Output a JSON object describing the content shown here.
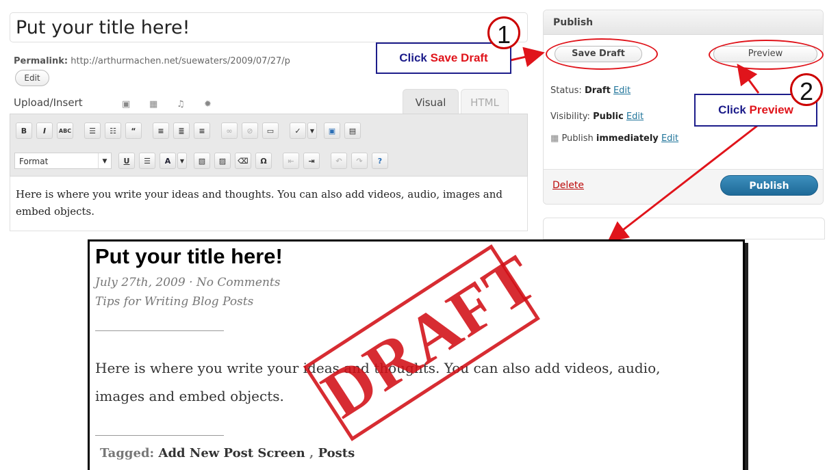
{
  "editor": {
    "title_value": "Put your title here!",
    "permalink_label": "Permalink:",
    "permalink_url": "http://arthurmachen.net/suewaters/2009/07/27/p",
    "edit_button": "Edit",
    "upload_insert_label": "Upload/Insert",
    "tabs": {
      "visual": "Visual",
      "html": "HTML"
    },
    "format_select": "Format",
    "body_text": "Here is where you write your ideas and thoughts.  You can also add videos, audio, images and embed objects."
  },
  "publish": {
    "header": "Publish",
    "save_draft_button": "Save Draft",
    "preview_button": "Preview",
    "status_label": "Status:",
    "status_value": "Draft",
    "visibility_label": "Visibility:",
    "visibility_value": "Public",
    "publish_prefix": "Publish",
    "publish_when": "immediately",
    "edit_link": "Edit",
    "delete_link": "Delete",
    "publish_button": "Publish"
  },
  "callouts": {
    "step1_number": "1",
    "step2_number": "2",
    "click_word": "Click",
    "save_draft": "Save Draft",
    "preview": "Preview"
  },
  "preview_page": {
    "title": "Put your title here!",
    "meta": "July 27th, 2009 · No Comments",
    "category": "Tips for Writing Blog Posts",
    "body": "Here is where you write your ideas and thoughts.  You can also add videos, audio, images and embed objects.",
    "tagged_label": "Tagged:",
    "tag1": "Add New Post Screen",
    "tag_sep": ",",
    "tag2": "Posts",
    "stamp": "DRAFT"
  },
  "colors": {
    "accent_red": "#e0141b",
    "callout_blue": "#1c1c8a",
    "link_blue": "#21759b",
    "publish_blue": "#2a7cad"
  }
}
